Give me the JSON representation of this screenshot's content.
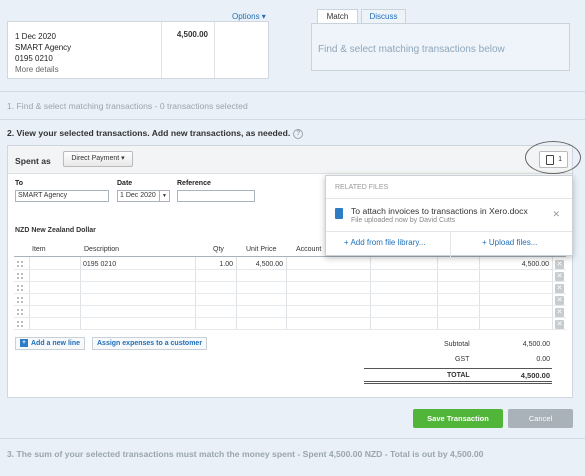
{
  "statement": {
    "date": "1 Dec 2020",
    "payee": "SMART Agency",
    "reference": "0195 0210",
    "more_details": "More details",
    "amount": "4,500.00"
  },
  "options_label": "Options ▾",
  "tabs": [
    {
      "label": "Match"
    },
    {
      "label": "Discuss"
    }
  ],
  "match_panel_text": "Find & select matching transactions below",
  "step1": "1. Find & select matching transactions - 0 transactions selected",
  "step2": "2. View your selected transactions. Add new transactions, as needed.",
  "step3": "3. The sum of your selected transactions must match the money spent - Spent 4,500.00 NZD - Total is out by 4,500.00",
  "spent_as": {
    "label": "Spent as",
    "type_button": "Direct Payment ▾",
    "files_count": "1"
  },
  "form": {
    "to_label": "To",
    "to_value": "SMART Agency",
    "date_label": "Date",
    "date_value": "1 Dec 2020",
    "reference_label": "Reference",
    "reference_value": ""
  },
  "currency": "NZD New Zealand Dollar",
  "grid": {
    "headers": [
      "Item",
      "Description",
      "Qty",
      "Unit Price",
      "Account"
    ],
    "rows": [
      {
        "description": "0195 0210",
        "qty": "1.00",
        "unit_price": "4,500.00",
        "amount": "4,500.00"
      },
      {
        "description": "",
        "qty": "",
        "unit_price": "",
        "amount": ""
      },
      {
        "description": "",
        "qty": "",
        "unit_price": "",
        "amount": ""
      },
      {
        "description": "",
        "qty": "",
        "unit_price": "",
        "amount": ""
      },
      {
        "description": "",
        "qty": "",
        "unit_price": "",
        "amount": ""
      },
      {
        "description": "",
        "qty": "",
        "unit_price": "",
        "amount": ""
      }
    ]
  },
  "add_line_label": "Add a new line",
  "assign_label": "Assign expenses to a customer",
  "totals": {
    "subtotal_label": "Subtotal",
    "subtotal": "4,500.00",
    "gst_label": "GST",
    "gst": "0.00",
    "total_label": "TOTAL",
    "total": "4,500.00"
  },
  "save_label": "Save Transaction",
  "cancel_label": "Cancel",
  "related_files": {
    "title": "RELATED FILES",
    "file_name": "To attach invoices to transactions in Xero.docx",
    "file_sub": "File uploaded now by David Cutts",
    "add_from_library": "+ Add from file library...",
    "upload": "+ Upload files..."
  },
  "colors": {
    "accent": "#1f6fba",
    "save": "#51b53a",
    "cancel": "#a9b2b9",
    "background": "#e9f0f7"
  },
  "icons": [
    "chevron-down-icon",
    "help-icon",
    "document-icon",
    "calendar-dropdown-icon",
    "drag-handle-icon",
    "delete-icon",
    "add-line-icon",
    "word-file-icon",
    "close-icon"
  ]
}
